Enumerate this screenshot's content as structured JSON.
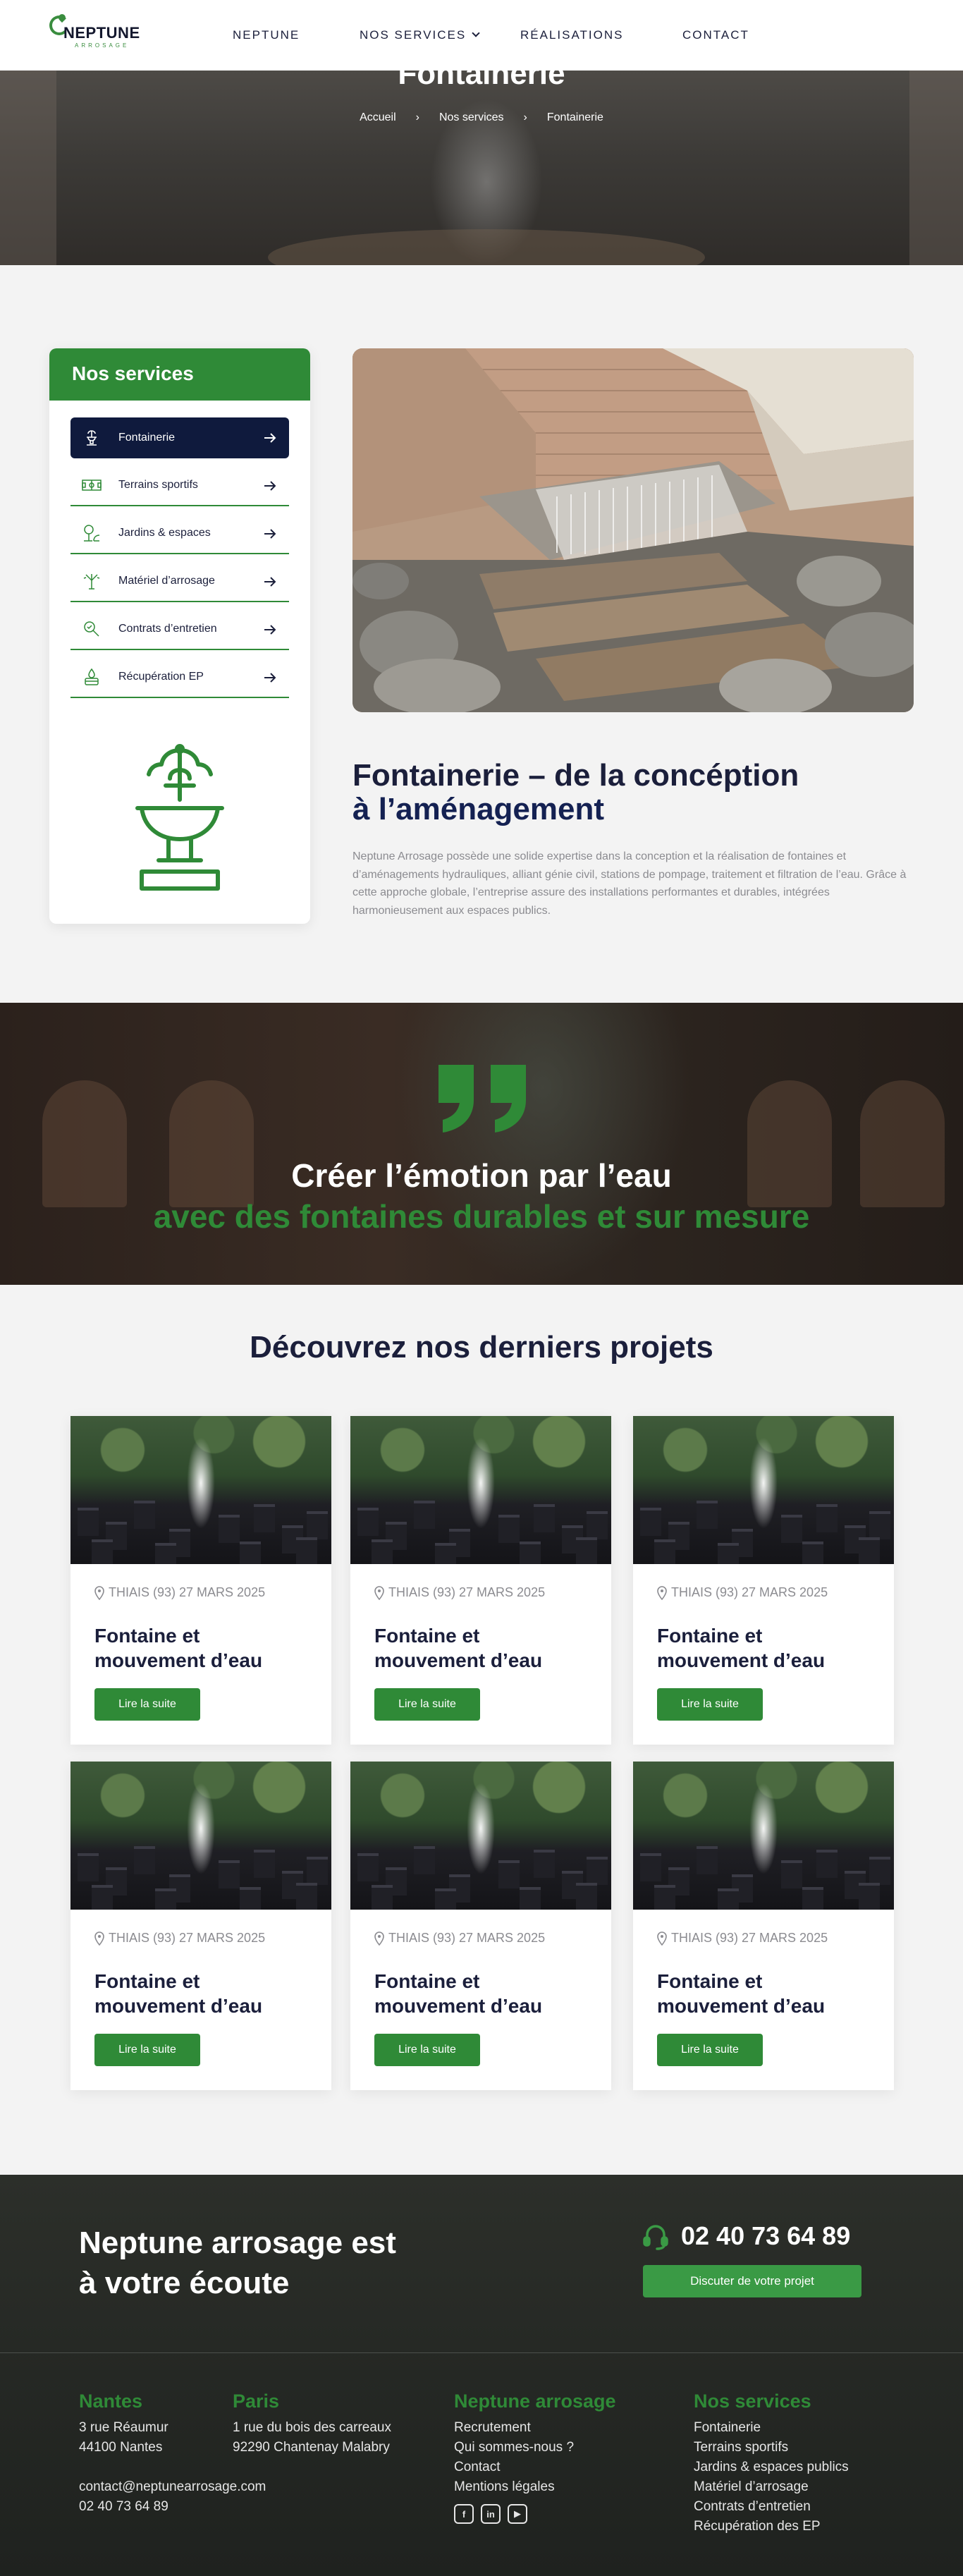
{
  "header": {
    "logo_name": "NEPTUNE",
    "logo_sub": "ARROSAGE",
    "nav": [
      "NEPTUNE",
      "NOS SERVICES",
      "RÉALISATIONS",
      "CONTACT"
    ]
  },
  "hero": {
    "title": "Fontainerie",
    "breadcrumb": [
      "Accueil",
      "›",
      "Nos services",
      "›",
      "Fontainerie"
    ]
  },
  "sidebar": {
    "title": "Nos services",
    "items": [
      {
        "label": "Fontainerie",
        "icon": "fountain-icon",
        "active": true
      },
      {
        "label": "Terrains sportifs",
        "icon": "field-icon",
        "active": false
      },
      {
        "label": "Jardins & espaces",
        "icon": "garden-icon",
        "active": false
      },
      {
        "label": "Matériel d’arrosage",
        "icon": "sprinkler-icon",
        "active": false
      },
      {
        "label": "Contrats d’entretien",
        "icon": "maintenance-icon",
        "active": false
      },
      {
        "label": "Récupération EP",
        "icon": "rainwater-icon",
        "active": false
      }
    ]
  },
  "main": {
    "title_line1": "Fontainerie – de la concéption",
    "title_line2": "à l’aménagement",
    "body": "Neptune Arrosage possède une solide expertise dans la conception et la réalisation de fontaines et d’aménagements hydrauliques, alliant génie civil, stations de pompage, traitement et filtration de l’eau. Grâce à cette approche globale, l’entreprise assure des installations performantes et durables, intégrées harmonieusement aux espaces publics."
  },
  "quote": {
    "line1": "Créer l’émotion par l’eau",
    "line2": "avec des fontaines durables et sur mesure"
  },
  "projects": {
    "title": "Découvrez nos derniers projets",
    "items": [
      {
        "location": "THIAIS (93) 27 MARS 2025",
        "title": "Fontaine et mouvement d’eau",
        "button": "Lire la suite"
      },
      {
        "location": "THIAIS (93) 27 MARS 2025",
        "title": "Fontaine et mouvement d’eau",
        "button": "Lire la suite"
      },
      {
        "location": "THIAIS (93) 27 MARS 2025",
        "title": "Fontaine et mouvement d’eau",
        "button": "Lire la suite"
      },
      {
        "location": "THIAIS (93) 27 MARS 2025",
        "title": "Fontaine et mouvement d’eau",
        "button": "Lire la suite"
      },
      {
        "location": "THIAIS (93) 27 MARS 2025",
        "title": "Fontaine et mouvement d’eau",
        "button": "Lire la suite"
      },
      {
        "location": "THIAIS (93) 27 MARS 2025",
        "title": "Fontaine et mouvement d’eau",
        "button": "Lire la suite"
      }
    ]
  },
  "footer": {
    "contact_line1": "Neptune arrosage est",
    "contact_line2": "à votre écoute",
    "phone": "02 40 73 64 89",
    "cta": "Discuter de votre projet",
    "nantes": {
      "title": "Nantes",
      "lines": [
        "3 rue Réaumur",
        "44100 Nantes"
      ],
      "email": "contact@neptunearrosage.com",
      "phone": "02 40 73 64 89"
    },
    "paris": {
      "title": "Paris",
      "lines": [
        "1 rue du bois des carreaux",
        "92290 Chantenay Malabry"
      ]
    },
    "neptune": {
      "title": "Neptune arrosage",
      "links": [
        "Recrutement",
        "Qui sommes-nous ?",
        "Contact",
        "Mentions légales"
      ]
    },
    "services": {
      "title": "Nos services",
      "links": [
        "Fontainerie",
        "Terrains sportifs",
        "Jardins & espaces publics",
        "Matériel d’arrosage",
        "Contrats d’entretien",
        "Récupération des EP"
      ]
    },
    "social_icons": [
      "facebook-icon",
      "linkedin-icon",
      "youtube-icon"
    ]
  },
  "colors": {
    "brand_green": "#2f8a37",
    "navy": "#0f1a3d",
    "text_dark": "#1b1f3b"
  }
}
